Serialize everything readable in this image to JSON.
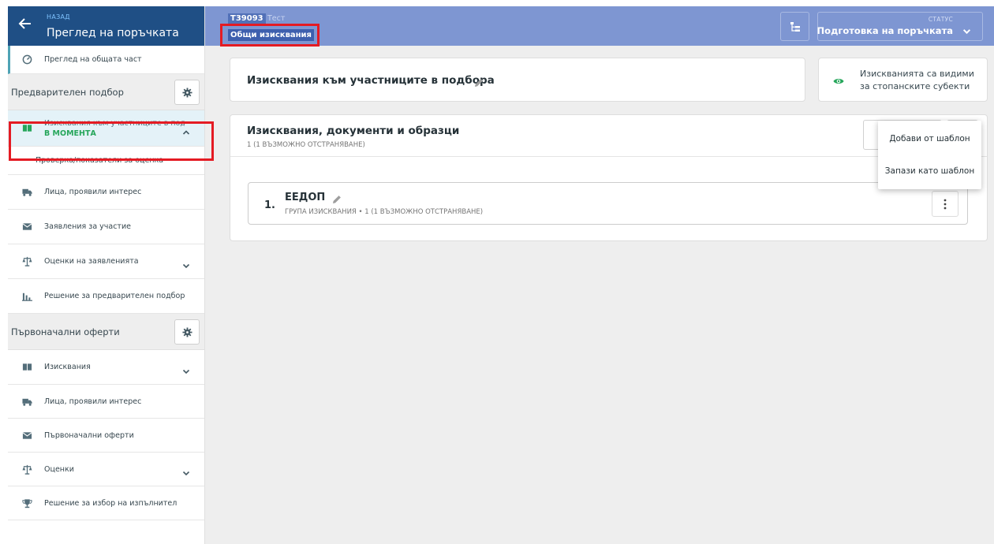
{
  "sidebar": {
    "back_sup": "НАЗАД",
    "title": "Преглед на поръчката",
    "overview": "Преглед на общата част",
    "sections": [
      {
        "title": "Предварителен подбор",
        "items": [
          {
            "label": "Изисквания към участниците в подбора",
            "badge": "В МОМЕНТА",
            "icon": "book-icon"
          },
          {
            "label": "Проверка/показатели за оценка"
          },
          {
            "label": "Лица, проявили интерес",
            "icon": "truck-icon"
          },
          {
            "label": "Заявления за участие",
            "icon": "envelope-icon"
          },
          {
            "label": "Оценки на заявленията",
            "icon": "scale-icon"
          },
          {
            "label": "Решение за предварителен подбор",
            "icon": "bar-chart-icon"
          }
        ]
      },
      {
        "title": "Първоначални оферти",
        "items": [
          {
            "label": "Изисквания",
            "icon": "book-icon"
          },
          {
            "label": "Лица, проявили интерес",
            "icon": "truck-icon"
          },
          {
            "label": "Първоначални оферти",
            "icon": "envelope-icon"
          },
          {
            "label": "Оценки",
            "icon": "scale-icon"
          },
          {
            "label": "Решение за избор на изпълнител",
            "icon": "trophy-icon"
          }
        ]
      }
    ]
  },
  "topbar": {
    "code": "T39093",
    "name": "Тест",
    "crumb": "Общи изисквания",
    "status_sup": "СТАТУС",
    "status": "Подготовка на поръчката"
  },
  "main": {
    "title": "Изисквания към участниците в подбора",
    "visibility": "Изискванията са видими за стопанските субекти",
    "requirements": {
      "title": "Изисквания, документи и образци",
      "sub": "1 (1 ВЪЗМОЖНО ОТСТРАНЯВАНЕ)",
      "group": {
        "number": "1.",
        "title": "ЕЕДОП",
        "sub": "ГРУПА ИЗИСКВАНИЯ • 1 (1 ВЪЗМОЖНО ОТСТРАНЯВАНЕ)"
      }
    },
    "menu": [
      "Добави от шаблон",
      "Запази като шаблон"
    ]
  },
  "colors": {
    "sidebar_header": "#1f4f85",
    "topbar": "#7e96d2",
    "active_item_bg": "#e4f2f8",
    "current_badge": "#26a65b",
    "highlight_border": "#e41b23"
  }
}
